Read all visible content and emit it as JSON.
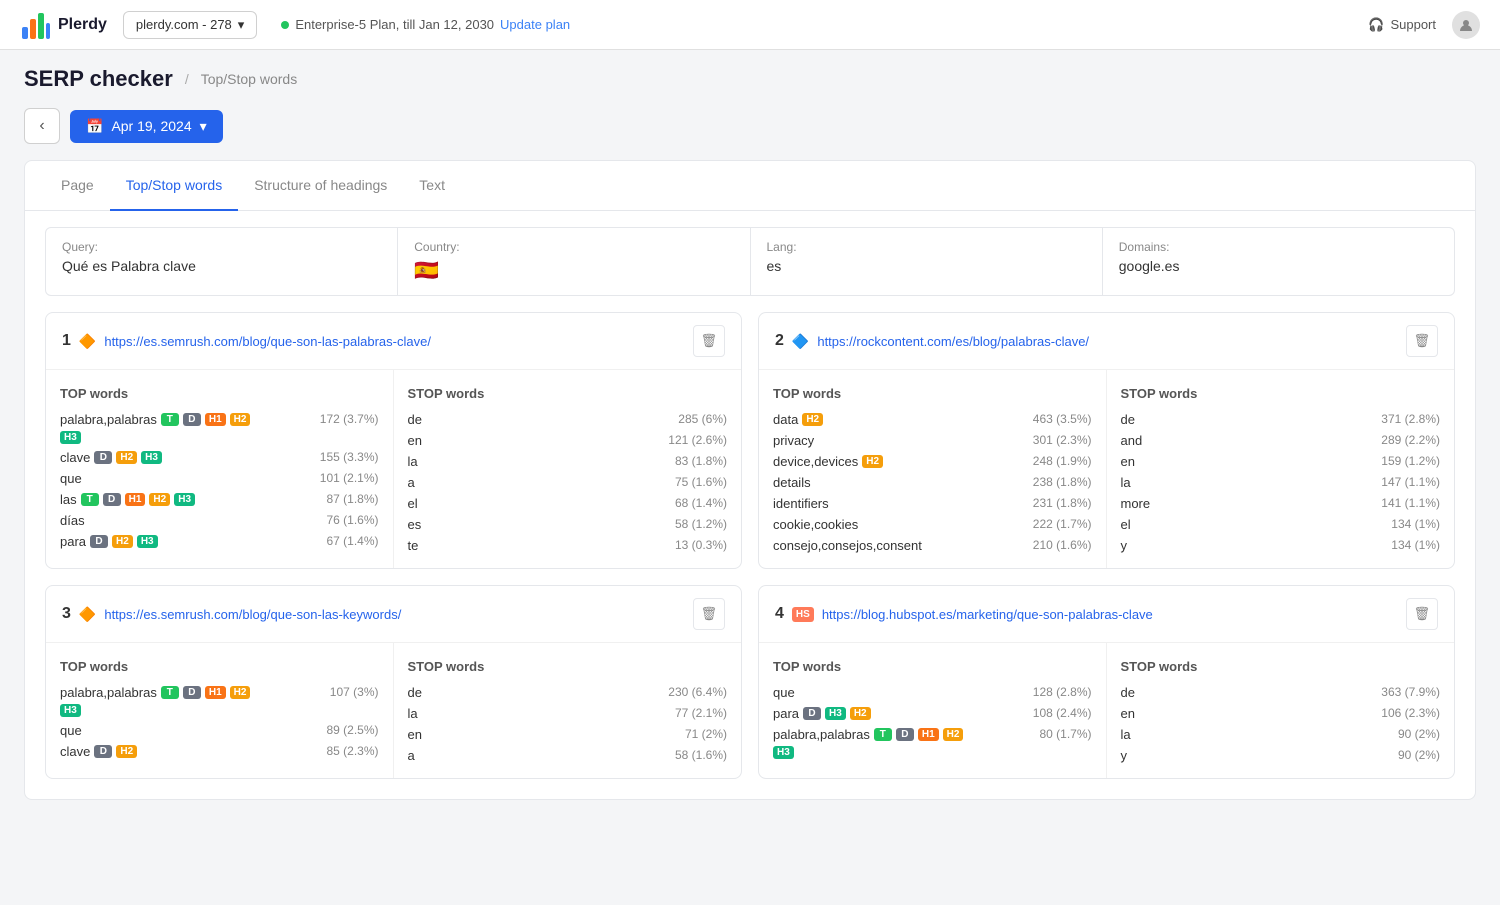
{
  "topbar": {
    "logo_text": "Plerdy",
    "site_selector": "plerdy.com - 278",
    "plan_text": "Enterprise-5 Plan, till Jan 12, 2030",
    "update_plan": "Update plan",
    "support": "Support"
  },
  "page": {
    "title": "SERP checker",
    "breadcrumb": "Top/Stop words"
  },
  "toolbar": {
    "back_label": "‹",
    "date_label": "Apr 19, 2024"
  },
  "tabs": [
    {
      "id": "page",
      "label": "Page"
    },
    {
      "id": "topstop",
      "label": "Top/Stop words",
      "active": true
    },
    {
      "id": "headings",
      "label": "Structure of headings"
    },
    {
      "id": "text",
      "label": "Text"
    }
  ],
  "query_bar": {
    "query_label": "Query:",
    "query_value": "Qué es Palabra clave",
    "country_label": "Country:",
    "country_value": "🇪🇸",
    "lang_label": "Lang:",
    "lang_value": "es",
    "domains_label": "Domains:",
    "domains_value": "google.es"
  },
  "results": [
    {
      "num": "1",
      "favicon_type": "semrush",
      "url": "https://es.semrush.com/blog/que-son-las-palabras-clave/",
      "top_words_header": "TOP words",
      "stop_words_header": "STOP words",
      "top_words": [
        {
          "word": "palabra,palabras",
          "badges": [
            "T",
            "D",
            "H1",
            "H2"
          ],
          "sub_badges": [
            "H3"
          ],
          "count": "172 (3.7%)"
        },
        {
          "word": "clave",
          "badges": [
            "D",
            "H2",
            "H3"
          ],
          "sub_badges": [],
          "count": "155 (3.3%)"
        },
        {
          "word": "que",
          "badges": [],
          "sub_badges": [],
          "count": "101 (2.1%)"
        },
        {
          "word": "las",
          "badges": [
            "T",
            "D",
            "H1",
            "H2",
            "H3"
          ],
          "sub_badges": [],
          "count": "87 (1.8%)"
        },
        {
          "word": "días",
          "badges": [],
          "sub_badges": [],
          "count": "76 (1.6%)"
        },
        {
          "word": "para",
          "badges": [
            "D",
            "H2",
            "H3"
          ],
          "sub_badges": [],
          "count": "67 (1.4%)"
        }
      ],
      "stop_words": [
        {
          "word": "de",
          "count": "285 (6%)"
        },
        {
          "word": "en",
          "count": "121 (2.6%)"
        },
        {
          "word": "la",
          "count": "83 (1.8%)"
        },
        {
          "word": "a",
          "count": "75 (1.6%)"
        },
        {
          "word": "el",
          "count": "68 (1.4%)"
        },
        {
          "word": "es",
          "count": "58 (1.2%)"
        },
        {
          "word": "te",
          "count": "13 (0.3%)"
        }
      ]
    },
    {
      "num": "2",
      "favicon_type": "rock",
      "url": "https://rockcontent.com/es/blog/palabras-clave/",
      "top_words_header": "TOP words",
      "stop_words_header": "STOP words",
      "top_words": [
        {
          "word": "data",
          "badges": [
            "H2"
          ],
          "sub_badges": [],
          "count": "463 (3.5%)"
        },
        {
          "word": "privacy",
          "badges": [],
          "sub_badges": [],
          "count": "301 (2.3%)"
        },
        {
          "word": "device,devices",
          "badges": [
            "H2"
          ],
          "sub_badges": [],
          "count": "248 (1.9%)"
        },
        {
          "word": "details",
          "badges": [],
          "sub_badges": [],
          "count": "238 (1.8%)"
        },
        {
          "word": "identifiers",
          "badges": [],
          "sub_badges": [],
          "count": "231 (1.8%)"
        },
        {
          "word": "cookie,cookies",
          "badges": [],
          "sub_badges": [],
          "count": "222 (1.7%)"
        },
        {
          "word": "consejo,consejos,consent",
          "badges": [],
          "sub_badges": [],
          "count": "210 (1.6%)"
        }
      ],
      "stop_words": [
        {
          "word": "de",
          "count": "371 (2.8%)"
        },
        {
          "word": "and",
          "count": "289 (2.2%)"
        },
        {
          "word": "en",
          "count": "159 (1.2%)"
        },
        {
          "word": "la",
          "count": "147 (1.1%)"
        },
        {
          "word": "more",
          "count": "141 (1.1%)"
        },
        {
          "word": "el",
          "count": "134 (1%)"
        },
        {
          "word": "y",
          "count": "134 (1%)"
        }
      ]
    },
    {
      "num": "3",
      "favicon_type": "semrush",
      "url": "https://es.semrush.com/blog/que-son-las-keywords/",
      "top_words_header": "TOP words",
      "stop_words_header": "STOP words",
      "top_words": [
        {
          "word": "palabra,palabras",
          "badges": [
            "T",
            "D",
            "H1",
            "H2"
          ],
          "sub_badges": [
            "H3"
          ],
          "count": "107 (3%)"
        },
        {
          "word": "que",
          "badges": [],
          "sub_badges": [],
          "count": "89 (2.5%)"
        },
        {
          "word": "clave",
          "badges": [
            "D",
            "H2"
          ],
          "sub_badges": [],
          "count": "85 (2.3%)"
        }
      ],
      "stop_words": [
        {
          "word": "de",
          "count": "230 (6.4%)"
        },
        {
          "word": "la",
          "count": "77 (2.1%)"
        },
        {
          "word": "en",
          "count": "71 (2%)"
        },
        {
          "word": "a",
          "count": "58 (1.6%)"
        }
      ]
    },
    {
      "num": "4",
      "favicon_type": "hubspot",
      "url": "https://blog.hubspot.es/marketing/que-son-palabras-clave",
      "top_words_header": "TOP words",
      "stop_words_header": "STOP words",
      "top_words": [
        {
          "word": "que",
          "badges": [],
          "sub_badges": [],
          "count": "128 (2.8%)"
        },
        {
          "word": "para",
          "badges": [
            "D",
            "H3",
            "H2"
          ],
          "sub_badges": [],
          "count": "108 (2.4%)"
        },
        {
          "word": "palabra,palabras",
          "badges": [
            "T",
            "D",
            "H1",
            "H2"
          ],
          "sub_badges": [
            "H3"
          ],
          "count": "80 (1.7%)"
        }
      ],
      "stop_words": [
        {
          "word": "de",
          "count": "363 (7.9%)"
        },
        {
          "word": "en",
          "count": "106 (2.3%)"
        },
        {
          "word": "la",
          "count": "90 (2%)"
        },
        {
          "word": "y",
          "count": "90 (2%)"
        }
      ]
    }
  ]
}
